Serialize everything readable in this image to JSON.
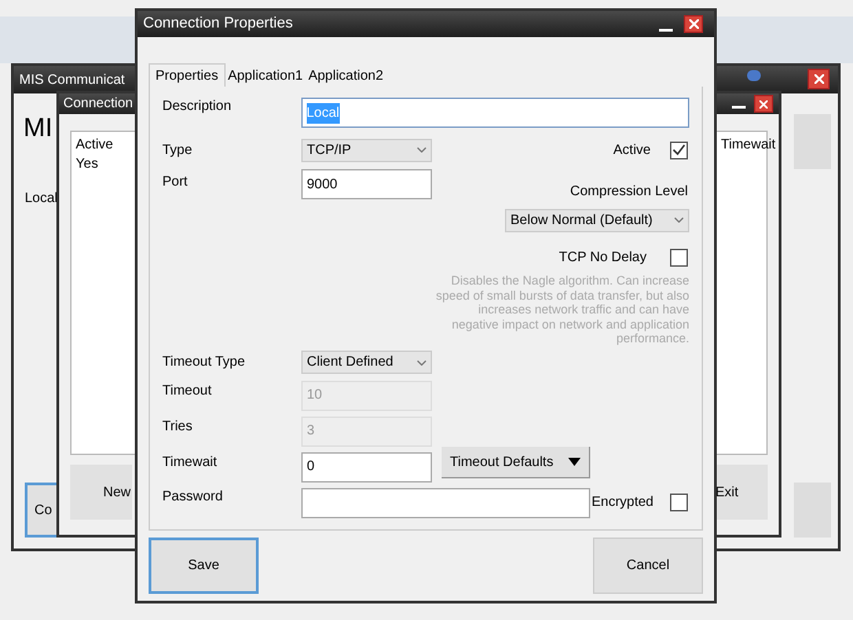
{
  "back_window": {
    "title": "MIS Communicat",
    "heading": "MI",
    "list_cell": "Local",
    "button": "Co"
  },
  "middle_window": {
    "title": "Connection",
    "columns": [
      "Active",
      "Timewait"
    ],
    "rows": [
      [
        "Yes"
      ]
    ],
    "buttons": [
      "New",
      "Exit"
    ]
  },
  "dialog": {
    "title": "Connection Properties",
    "tabs": [
      {
        "label": "Properties",
        "selected": true
      },
      {
        "label": "Application1",
        "selected": false
      },
      {
        "label": "Application2",
        "selected": false
      }
    ],
    "description": {
      "label": "Description",
      "value": "Local",
      "highlighted": true
    },
    "type": {
      "label": "Type",
      "value": "TCP/IP"
    },
    "active": {
      "label": "Active",
      "checked": true
    },
    "port": {
      "label": "Port",
      "value": "9000"
    },
    "compression": {
      "label": "Compression Level",
      "value": "Below Normal (Default)"
    },
    "tcp_no_delay": {
      "label": "TCP No Delay",
      "checked": false,
      "note": "Disables the Nagle algorithm. Can increase speed of small bursts of data transfer, but also increases network traffic and can have negative impact on network and application performance."
    },
    "timeout_type": {
      "label": "Timeout Type",
      "value": "Client Defined"
    },
    "timeout": {
      "label": "Timeout",
      "value": "10",
      "disabled": true
    },
    "tries": {
      "label": "Tries",
      "value": "3",
      "disabled": true
    },
    "timewait": {
      "label": "Timewait",
      "value": "0",
      "disabled": false
    },
    "timeout_defaults": "Timeout Defaults",
    "password": {
      "label": "Password"
    },
    "encrypted": {
      "label": "Encrypted",
      "checked": false
    },
    "buttons": [
      "Save",
      "Cancel"
    ]
  }
}
